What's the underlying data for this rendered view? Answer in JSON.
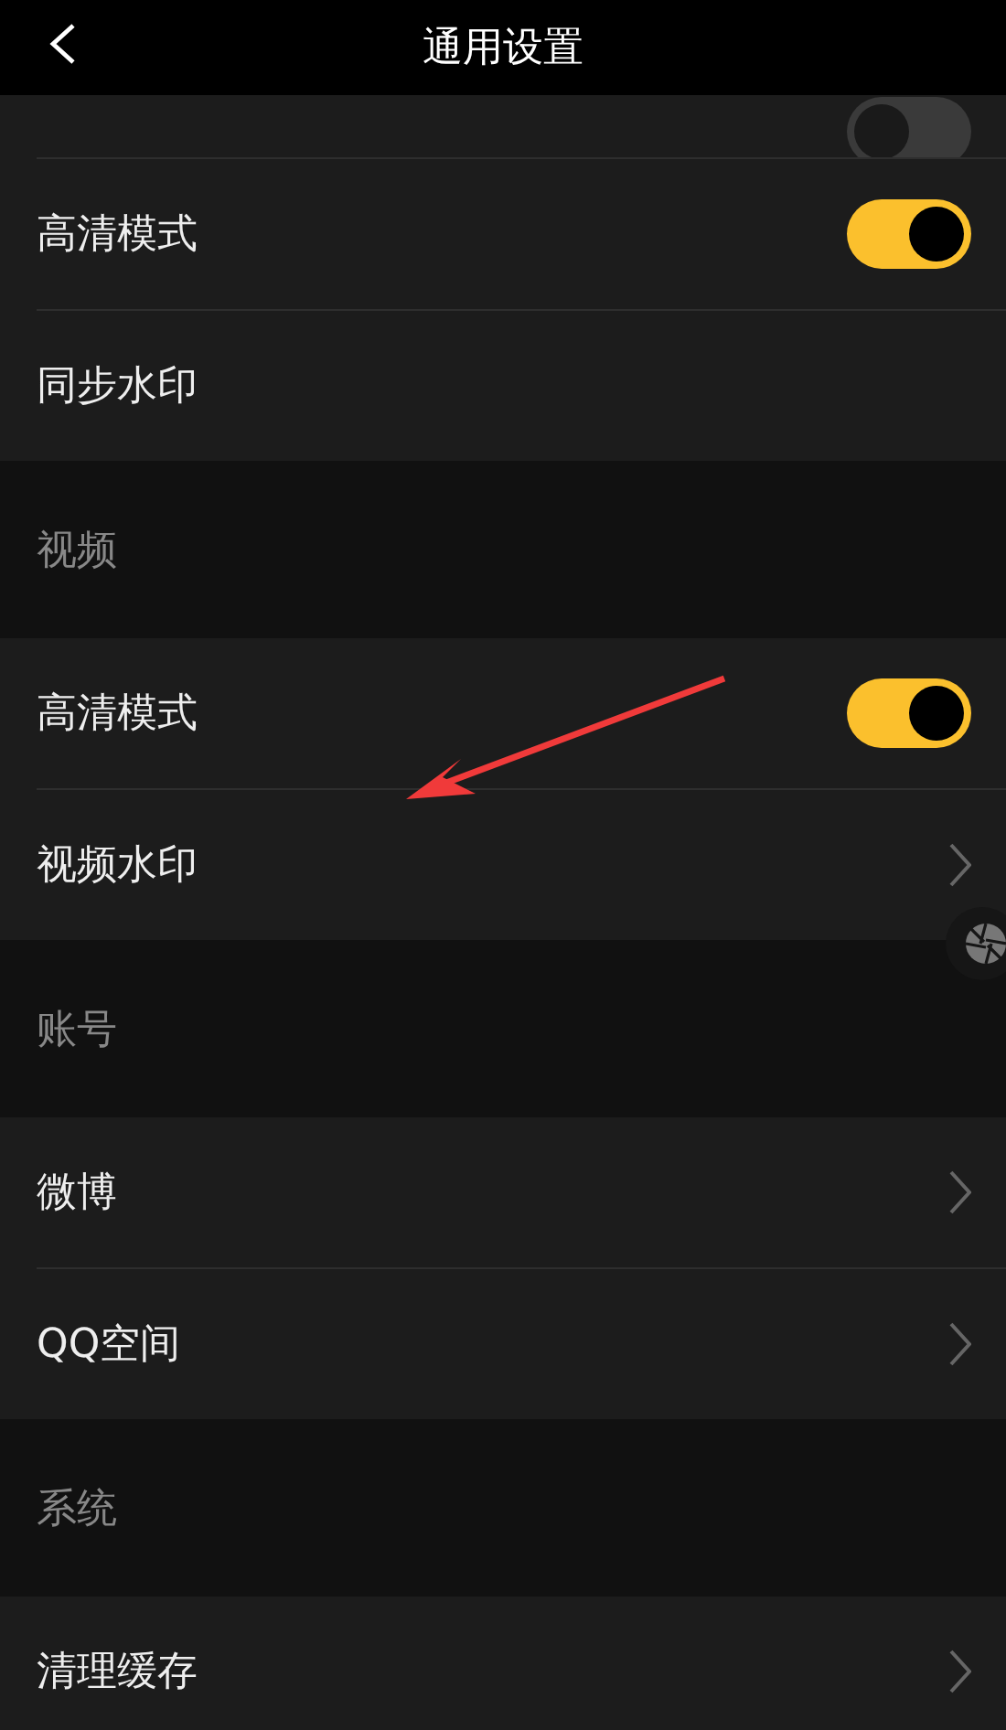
{
  "header": {
    "title": "通用设置"
  },
  "groups": [
    {
      "rows": [
        {
          "kind": "toggle",
          "on": false,
          "cut": true
        },
        {
          "kind": "toggle",
          "label": "高清模式",
          "on": true
        },
        {
          "kind": "plain",
          "label": "同步水印"
        }
      ]
    },
    {
      "title": "视频",
      "rows": [
        {
          "kind": "toggle",
          "label": "高清模式",
          "on": true
        },
        {
          "kind": "link",
          "label": "视频水印"
        }
      ]
    },
    {
      "title": "账号",
      "rows": [
        {
          "kind": "link",
          "label": "微博"
        },
        {
          "kind": "link",
          "label": "QQ空间"
        }
      ]
    },
    {
      "title": "系统",
      "rows": [
        {
          "kind": "link",
          "label": "清理缓存"
        }
      ]
    }
  ]
}
